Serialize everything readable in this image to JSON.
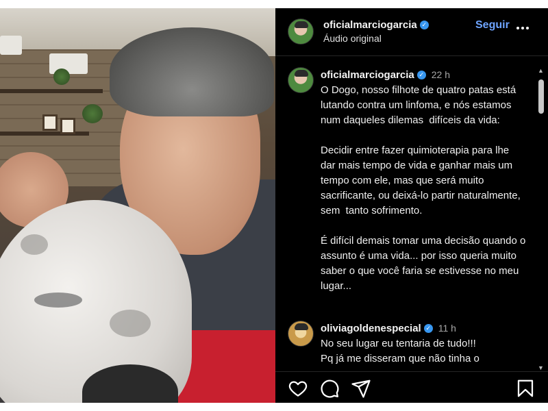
{
  "post": {
    "username": "oficialmarciogarcia",
    "subtitle": "Áudio original",
    "follow_label": "Seguir",
    "more_label": "•••"
  },
  "caption": {
    "username": "oficialmarciogarcia",
    "time": "22 h",
    "text": "O Dogo, nosso filhote de quatro patas está lutando contra um linfoma, e nós estamos num daqueles dilemas  difíceis da vida:\n\nDecidir entre fazer quimioterapia para lhe dar mais tempo de vida e ganhar mais um tempo com ele, mas que será muito sacrificante, ou deixá-lo partir naturalmente, sem  tanto sofrimento.\n\nÉ difícil demais tomar uma decisão quando o assunto é uma vida... por isso queria muito saber o que você faria se estivesse no meu lugar..."
  },
  "reply": {
    "username": "oliviagoldenespecial",
    "time": "11 h",
    "text": "No seu lugar eu tentaria de tudo!!!\nPq já me disseram que não tinha o"
  },
  "icons": {
    "verified": "verified-badge-icon",
    "like": "heart-icon",
    "comment": "comment-icon",
    "share": "share-icon",
    "save": "bookmark-icon"
  },
  "colors": {
    "background": "#000000",
    "follow": "#6ea4ff",
    "verified": "#3897f0",
    "muted": "#a8a8a8"
  }
}
